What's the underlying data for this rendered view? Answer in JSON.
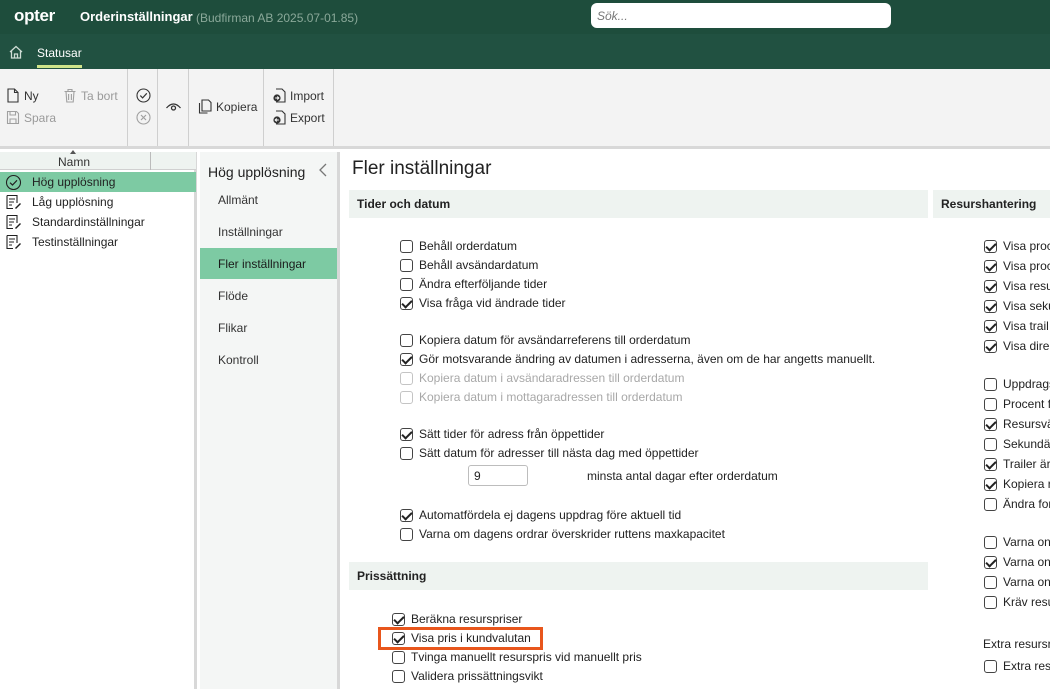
{
  "header": {
    "logo": "opter",
    "app_title": "Orderinställningar",
    "subtitle": "(Budfirman AB 2025.07-01.85)",
    "search_placeholder": "Sök..."
  },
  "nav": {
    "tab_label": "Statusar"
  },
  "toolbar": {
    "new": "Ny",
    "delete": "Ta bort",
    "save": "Spara",
    "copy": "Kopiera",
    "import": "Import",
    "export": "Export"
  },
  "left_panel": {
    "column_header": "Namn",
    "items": [
      {
        "label": "Hög upplösning",
        "selected": true
      },
      {
        "label": "Låg upplösning"
      },
      {
        "label": "Standardinställningar"
      },
      {
        "label": "Testinställningar"
      }
    ]
  },
  "mid_panel": {
    "title": "Hög upplösning",
    "items": [
      "Allmänt",
      "Inställningar",
      "Fler inställningar",
      "Flöde",
      "Flikar",
      "Kontroll"
    ],
    "selected_index": 2
  },
  "main": {
    "title": "Fler inställningar",
    "section1": {
      "title": "Tider och datum",
      "options": [
        {
          "label": "Behåll orderdatum",
          "checked": false
        },
        {
          "label": "Behåll avsändardatum",
          "checked": false
        },
        {
          "label": "Ändra efterföljande tider",
          "checked": false
        },
        {
          "label": "Visa fråga vid ändrade tider",
          "checked": true
        },
        {
          "label": "Kopiera datum för avsändarreferens till orderdatum",
          "checked": false
        },
        {
          "label": "Gör motsvarande ändring av datumen i adresserna, även om de har angetts manuellt.",
          "checked": true
        },
        {
          "label": "Kopiera datum i avsändaradressen till orderdatum",
          "checked": false,
          "disabled": true
        },
        {
          "label": "Kopiera datum i mottagaradressen till orderdatum",
          "checked": false,
          "disabled": true
        },
        {
          "label": "Sätt tider för adress från öppettider",
          "checked": true
        },
        {
          "label": "Sätt datum för adresser till nästa dag med öppettider",
          "checked": false
        },
        {
          "label": "Automatfördela ej dagens uppdrag före aktuell tid",
          "checked": true
        },
        {
          "label": "Varna om dagens ordrar överskrider ruttens maxkapacitet",
          "checked": false
        }
      ],
      "days_value": "9",
      "days_label": "minsta antal dagar efter orderdatum"
    },
    "section2": {
      "title": "Prissättning",
      "options": [
        {
          "label": "Beräkna resurspriser",
          "checked": true
        },
        {
          "label": "Visa pris i kundvalutan",
          "checked": true
        },
        {
          "label": "Tvinga manuellt resurspris vid manuellt pris",
          "checked": false
        },
        {
          "label": "Validera prissättningsvikt",
          "checked": false
        }
      ]
    },
    "section3": {
      "title": "Resurshantering",
      "options": [
        {
          "label": "Visa proc",
          "checked": true
        },
        {
          "label": "Visa proc",
          "checked": true
        },
        {
          "label": "Visa resu",
          "checked": true
        },
        {
          "label": "Visa seku",
          "checked": true
        },
        {
          "label": "Visa trail",
          "checked": true
        },
        {
          "label": "Visa dire",
          "checked": true
        },
        {
          "label": "Uppdrags",
          "checked": false
        },
        {
          "label": "Procent f",
          "checked": false
        },
        {
          "label": "Resursvä",
          "checked": true
        },
        {
          "label": "Sekundä",
          "checked": false
        },
        {
          "label": "Trailer är",
          "checked": true
        },
        {
          "label": "Kopiera r",
          "checked": true
        },
        {
          "label": "Ändra for",
          "checked": false
        },
        {
          "label": "Varna on",
          "checked": false
        },
        {
          "label": "Varna on",
          "checked": true
        },
        {
          "label": "Varna on",
          "checked": false
        },
        {
          "label": "Kräv resu",
          "checked": false
        }
      ],
      "extra_label": "Extra resursr",
      "extra_option": {
        "label": "Extra res",
        "checked": false
      }
    }
  }
}
